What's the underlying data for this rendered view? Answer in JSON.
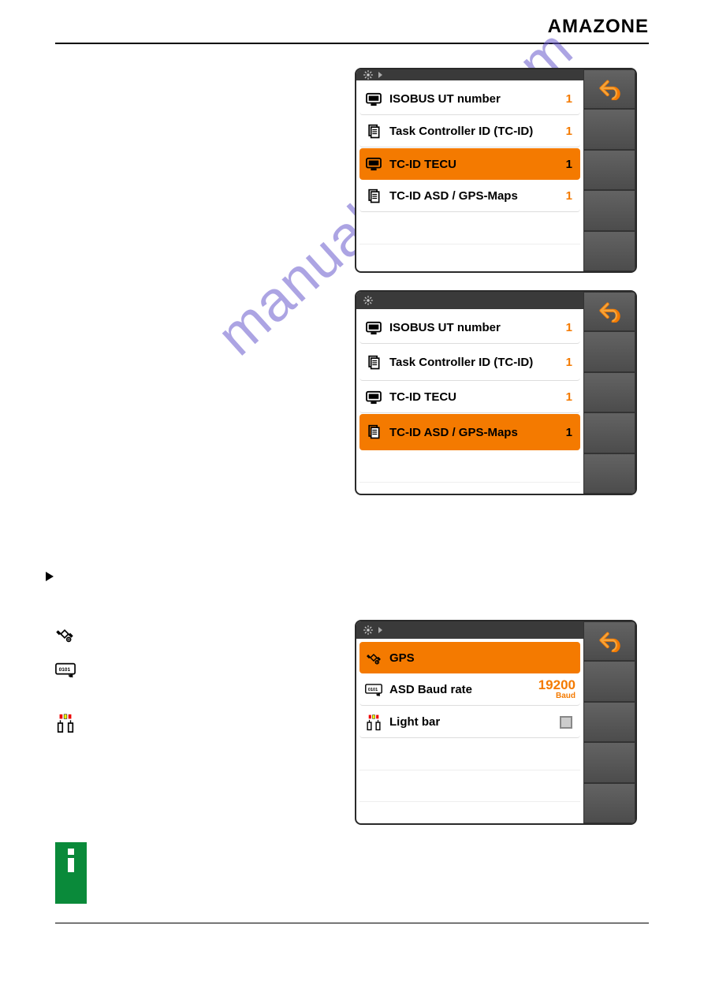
{
  "brand": "AMAZONE",
  "watermark": "manualshive.com",
  "screens": {
    "s1": {
      "rows": [
        {
          "icon": "monitor",
          "label": "ISOBUS UT number",
          "value": "1",
          "selected": false
        },
        {
          "icon": "file",
          "label": "Task Controller ID (TC-ID)",
          "value": "1",
          "selected": false
        },
        {
          "icon": "monitor",
          "label": "TC-ID TECU",
          "value": "1",
          "selected": true
        },
        {
          "icon": "file",
          "label": "TC-ID ASD / GPS-Maps",
          "value": "1",
          "selected": false
        }
      ]
    },
    "s2": {
      "rows": [
        {
          "icon": "monitor",
          "label": "ISOBUS UT number",
          "value": "1",
          "selected": false
        },
        {
          "icon": "file",
          "label": "Task Controller ID (TC-ID)",
          "value": "1",
          "selected": false
        },
        {
          "icon": "monitor",
          "label": "TC-ID TECU",
          "value": "1",
          "selected": false
        },
        {
          "icon": "file",
          "label": "TC-ID ASD / GPS-Maps",
          "value": "1",
          "selected": true
        }
      ]
    },
    "s3": {
      "rows": [
        {
          "icon": "sat",
          "label": "GPS",
          "value": "",
          "selected": true
        },
        {
          "icon": "baud",
          "label": "ASD Baud rate",
          "value": "19200",
          "unit": "Baud",
          "selected": false
        },
        {
          "icon": "light",
          "label": "Light bar",
          "value": "checkbox",
          "selected": false
        }
      ]
    }
  }
}
